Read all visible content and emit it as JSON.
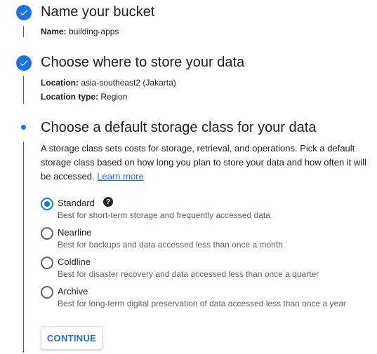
{
  "steps": [
    {
      "title": "Name your bucket",
      "fields": [
        {
          "label": "Name:",
          "value": "building-apps"
        }
      ]
    },
    {
      "title": "Choose where to store your data",
      "fields": [
        {
          "label": "Location:",
          "value": "asia-southeast2 (Jakarta)"
        },
        {
          "label": "Location type:",
          "value": "Region"
        }
      ]
    },
    {
      "title": "Choose a default storage class for your data",
      "description": "A storage class sets costs for storage, retrieval, and operations. Pick a default storage class based on how long you plan to store your data and how often it will be accessed.",
      "learn_more": "Learn more",
      "help_glyph": "?",
      "options": [
        {
          "label": "Standard",
          "sub": "Best for short-term storage and frequently accessed data",
          "selected": true
        },
        {
          "label": "Nearline",
          "sub": "Best for backups and data accessed less than once a month",
          "selected": false
        },
        {
          "label": "Coldline",
          "sub": "Best for disaster recovery and data accessed less than once a quarter",
          "selected": false
        },
        {
          "label": "Archive",
          "sub": "Best for long-term digital preservation of data accessed less than once a year",
          "selected": false
        }
      ],
      "continue_label": "CONTINUE"
    }
  ],
  "colors": {
    "accent": "#1a73e8",
    "text": "#202124",
    "muted": "#5f6368"
  },
  "icons": {
    "completed": "check-circle-icon",
    "current": "dot-icon",
    "help": "help-icon"
  }
}
